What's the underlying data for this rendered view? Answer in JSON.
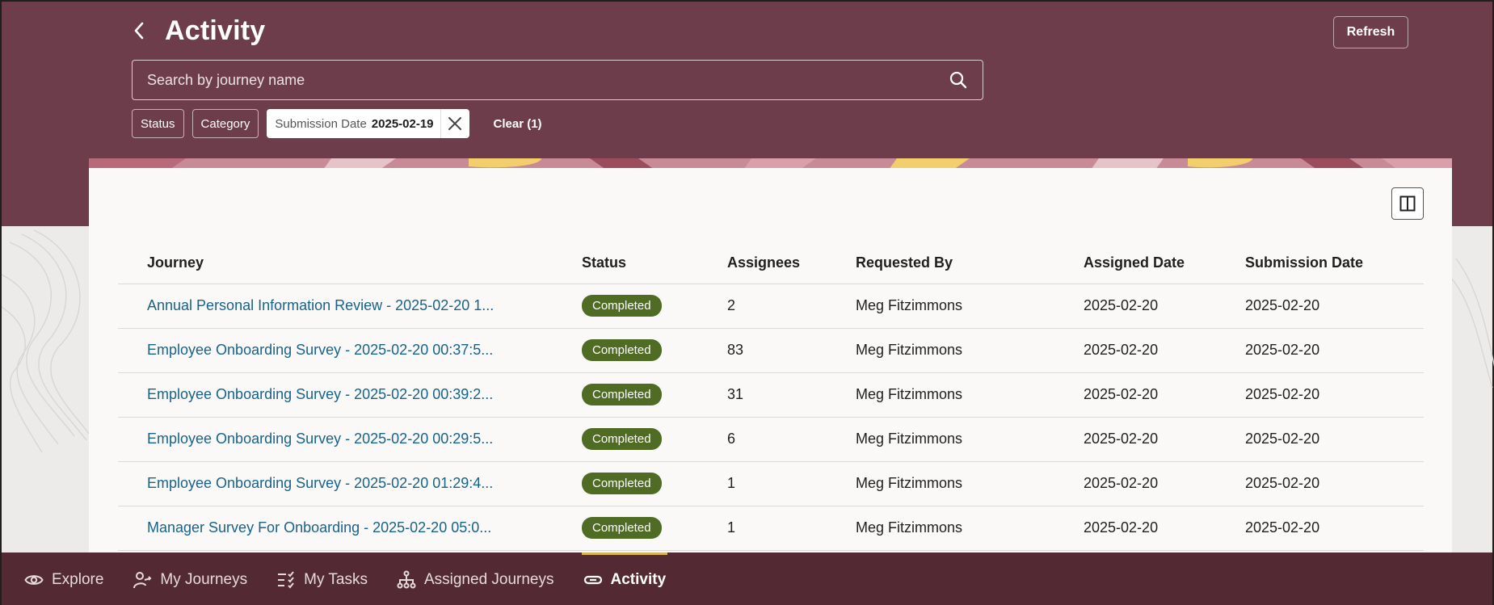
{
  "header": {
    "title": "Activity",
    "refresh_label": "Refresh"
  },
  "search": {
    "placeholder": "Search by journey name",
    "value": ""
  },
  "filters": {
    "status_label": "Status",
    "category_label": "Category",
    "submission_date_label": "Submission Date",
    "submission_date_value": "2025-02-19",
    "clear_label": "Clear (1)"
  },
  "table": {
    "columns": [
      "Journey",
      "Status",
      "Assignees",
      "Requested By",
      "Assigned Date",
      "Submission Date"
    ],
    "rows": [
      {
        "journey": "Annual Personal Information Review - 2025-02-20 1...",
        "status": "Completed",
        "assignees": "2",
        "requested_by": "Meg Fitzimmons",
        "assigned_date": "2025-02-20",
        "submission_date": "2025-02-20"
      },
      {
        "journey": "Employee Onboarding Survey - 2025-02-20 00:37:5...",
        "status": "Completed",
        "assignees": "83",
        "requested_by": "Meg Fitzimmons",
        "assigned_date": "2025-02-20",
        "submission_date": "2025-02-20"
      },
      {
        "journey": "Employee Onboarding Survey - 2025-02-20 00:39:2...",
        "status": "Completed",
        "assignees": "31",
        "requested_by": "Meg Fitzimmons",
        "assigned_date": "2025-02-20",
        "submission_date": "2025-02-20"
      },
      {
        "journey": "Employee Onboarding Survey - 2025-02-20 00:29:5...",
        "status": "Completed",
        "assignees": "6",
        "requested_by": "Meg Fitzimmons",
        "assigned_date": "2025-02-20",
        "submission_date": "2025-02-20"
      },
      {
        "journey": "Employee Onboarding Survey - 2025-02-20 01:29:4...",
        "status": "Completed",
        "assignees": "1",
        "requested_by": "Meg Fitzimmons",
        "assigned_date": "2025-02-20",
        "submission_date": "2025-02-20"
      },
      {
        "journey": "Manager Survey For Onboarding - 2025-02-20 05:0...",
        "status": "Completed",
        "assignees": "1",
        "requested_by": "Meg Fitzimmons",
        "assigned_date": "2025-02-20",
        "submission_date": "2025-02-20"
      }
    ]
  },
  "nav": {
    "items": [
      {
        "label": "Explore",
        "icon": "eye-icon"
      },
      {
        "label": "My Journeys",
        "icon": "person-route-icon"
      },
      {
        "label": "My Tasks",
        "icon": "task-list-icon"
      },
      {
        "label": "Assigned Journeys",
        "icon": "hierarchy-icon"
      },
      {
        "label": "Activity",
        "icon": "link-icon"
      }
    ],
    "active": "Activity"
  },
  "colors": {
    "header_bg": "#6e3d4b",
    "nav_bg": "#532a33",
    "badge_green": "#4f6b24",
    "link_blue": "#17638a",
    "active_indicator": "#d9b356"
  }
}
